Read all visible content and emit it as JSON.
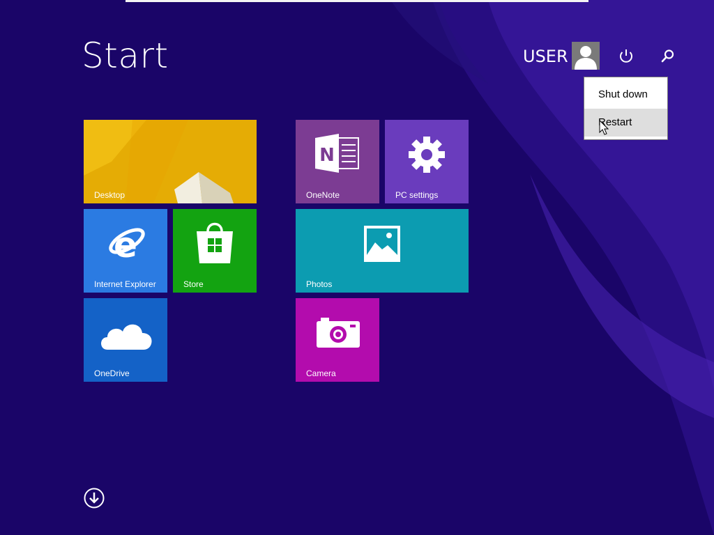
{
  "screen": {
    "title": "Start"
  },
  "user": {
    "name": "USER"
  },
  "power_menu": {
    "shutdown_label": "Shut down",
    "restart_label": "Restart"
  },
  "tiles": [
    {
      "label": "Desktop",
      "color": "#e5ac05"
    },
    {
      "label": "OneNote",
      "color": "#7c3c93"
    },
    {
      "label": "PC settings",
      "color": "#6a3cbd"
    },
    {
      "label": "Internet Explorer",
      "color": "#2b7be2"
    },
    {
      "label": "Store",
      "color": "#13a311"
    },
    {
      "label": "Photos",
      "color": "#0c9cb1"
    },
    {
      "label": "OneDrive",
      "color": "#1462c7"
    },
    {
      "label": "Camera",
      "color": "#b30cad"
    }
  ],
  "icons": {
    "user": "avatar-icon",
    "power": "power-icon",
    "search": "search-icon",
    "all_apps": "arrow-down-circle-icon"
  },
  "colors": {
    "background": "#1a0568",
    "menu_highlight": "#dedede"
  }
}
